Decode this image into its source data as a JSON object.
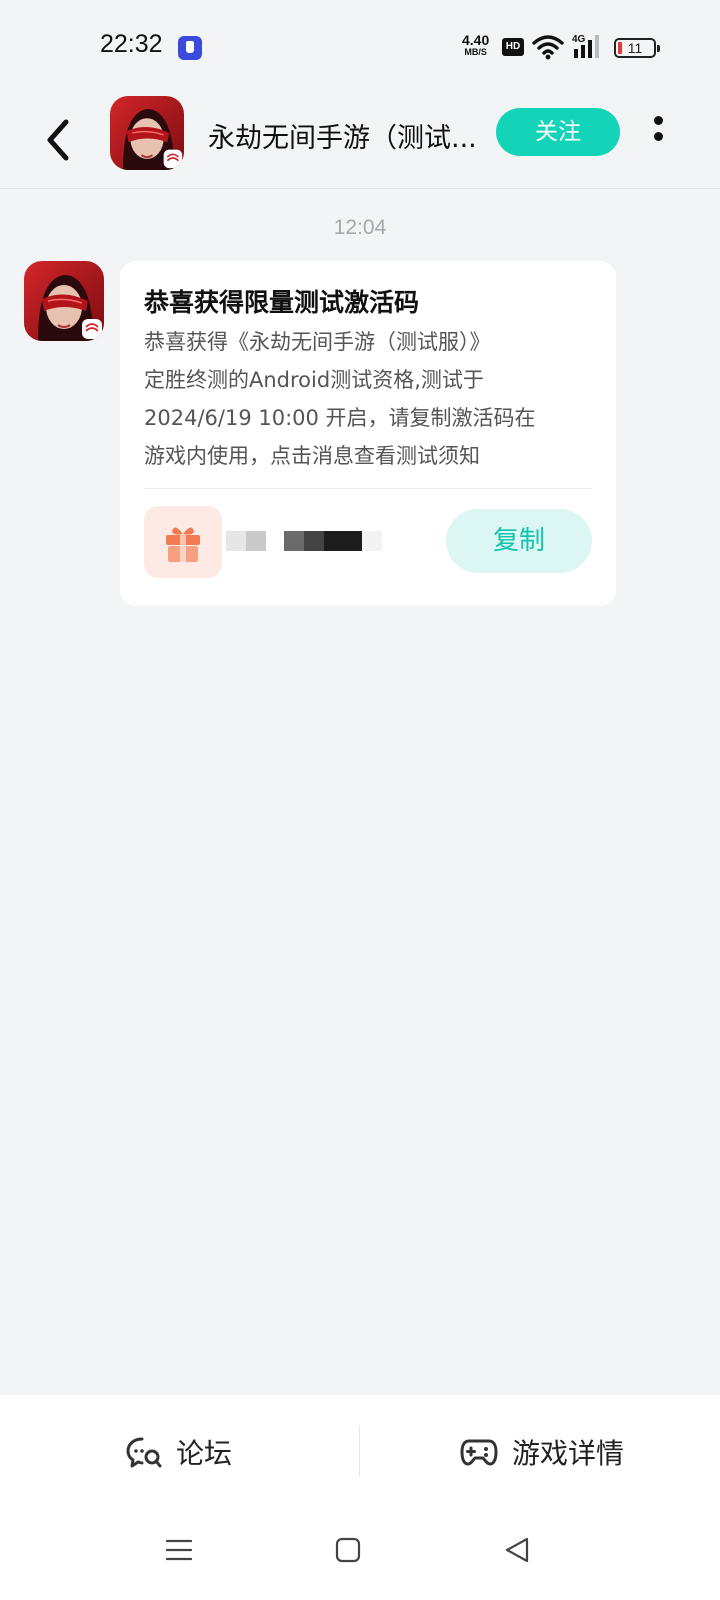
{
  "status_bar": {
    "time": "22:32",
    "net_speed_value": "4.40",
    "net_speed_unit": "MB/S",
    "hd_label": "HD",
    "network_type": "4G",
    "battery_level": "11"
  },
  "header": {
    "title": "永劫无间手游（测试...",
    "follow_label": "关注"
  },
  "chat": {
    "timestamp": "12:04",
    "message": {
      "title": "恭喜获得限量测试激活码",
      "body_lines": [
        "恭喜获得《永劫无间手游（测试服）》",
        "定胜终测的Android测试资格,测试于",
        "2024/6/19 10:00 开启，请复制激活码在",
        "游戏内使用，点击消息查看测试须知"
      ],
      "copy_label": "复制"
    }
  },
  "bottom_bar": {
    "forum_label": "论坛",
    "details_label": "游戏详情"
  },
  "colors": {
    "accent": "#13d3b9",
    "background": "#f3f4f6",
    "gift": "#f27b54"
  }
}
